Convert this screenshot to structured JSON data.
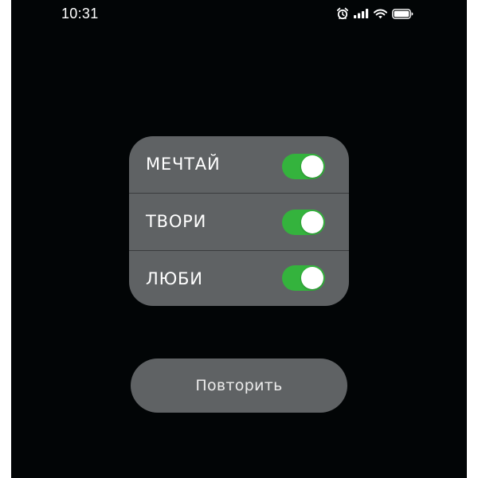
{
  "status_bar": {
    "time": "10:31",
    "icons": [
      "alarm-icon",
      "cellular-signal-icon",
      "wifi-icon",
      "battery-icon"
    ]
  },
  "toggles": [
    {
      "label": "МЕЧТАЙ",
      "on": true
    },
    {
      "label": "ТВОРИ",
      "on": true
    },
    {
      "label": "ЛЮБИ",
      "on": true
    }
  ],
  "repeat_button": {
    "label": "Повторить"
  },
  "colors": {
    "background": "#020506",
    "card": "#5f6264",
    "switch_on": "#34b33d",
    "knob": "#ffffff",
    "text": "#ffffff"
  }
}
